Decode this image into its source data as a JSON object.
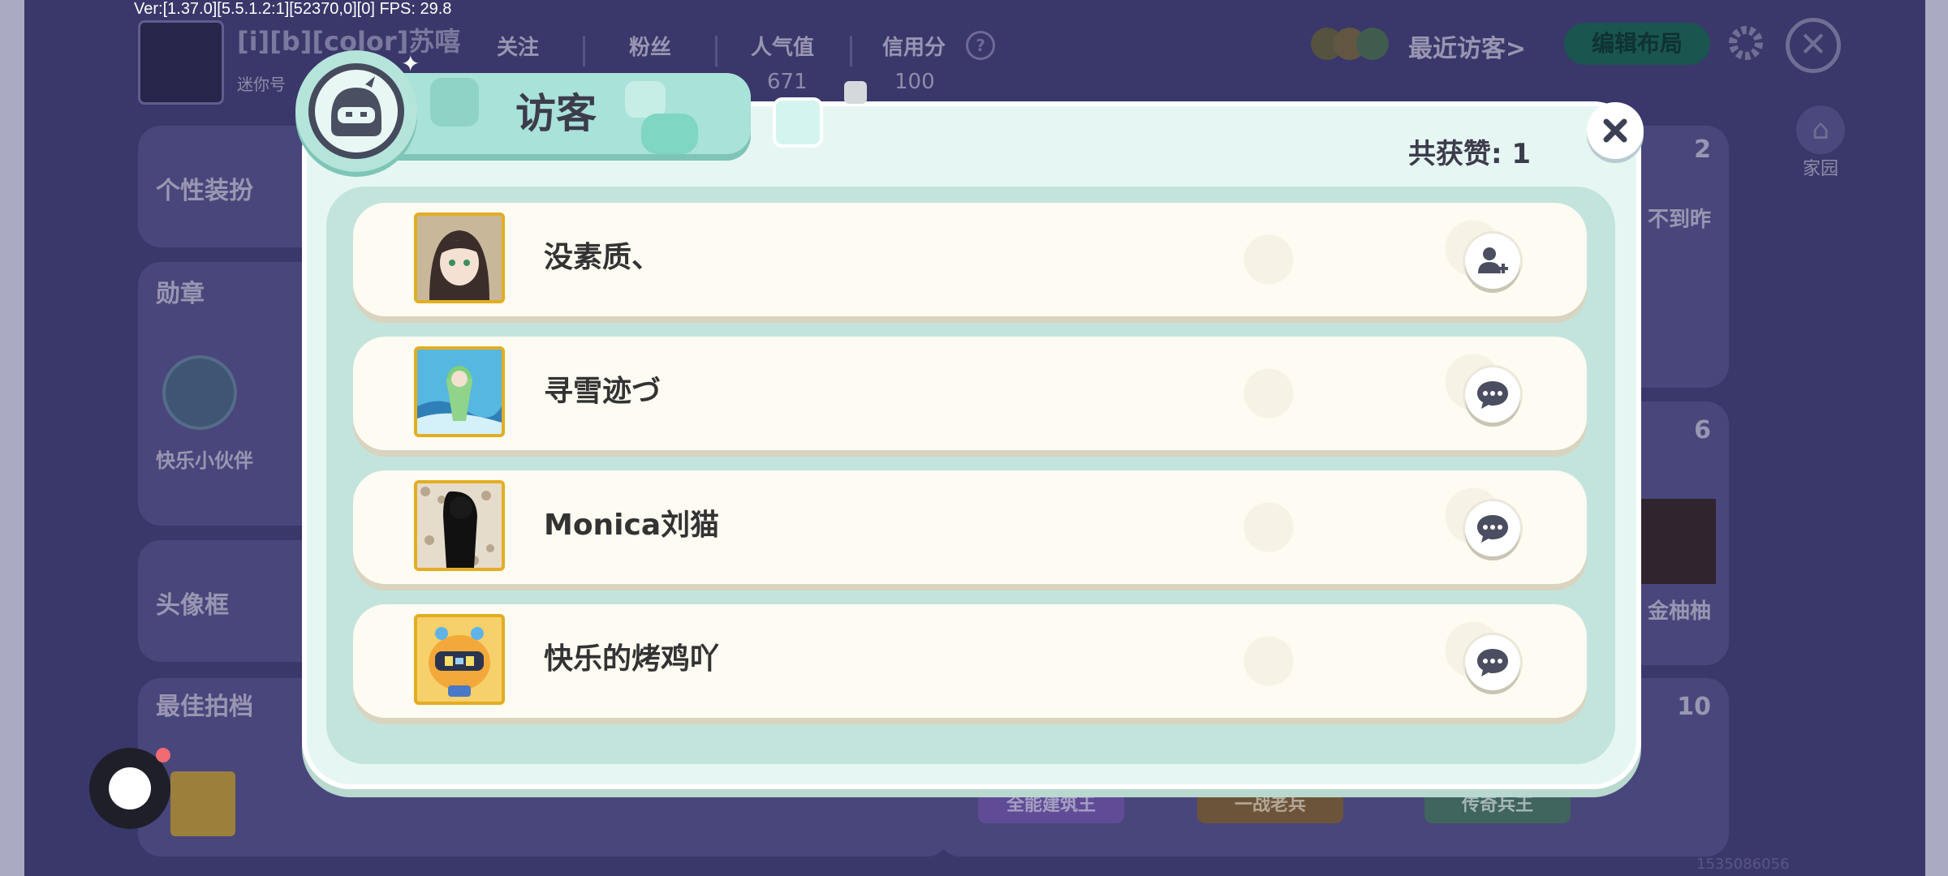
{
  "debug": {
    "text": "Ver:[1.37.0][5.5.1.2:1][52370,0][0] FPS: 29.8"
  },
  "profile": {
    "name": "[i][b][color]苏嘻",
    "mini_id_label": "迷你号",
    "stats": [
      {
        "label": "关注",
        "value": ""
      },
      {
        "label": "粉丝",
        "value": ""
      },
      {
        "label": "人气值",
        "value": "671"
      },
      {
        "label": "信用分",
        "value": "100"
      }
    ]
  },
  "header": {
    "recent_visitors": "最近访客>",
    "edit_layout": "编辑布局",
    "home": "家园"
  },
  "background_sections": {
    "dress": "个性装扮",
    "medals": "勋章",
    "medal_item": "快乐小伙伴",
    "frames": "头像框",
    "partners": "最佳拍档",
    "right_count_1": "2",
    "right_text_1": "不到昨",
    "right_count_2": "6",
    "right_text_2": "金柚柚",
    "right_count_3": "10",
    "badges": [
      "全能建筑王",
      "一战老兵",
      "传奇兵王"
    ],
    "footer_id": "1535086056"
  },
  "dialog": {
    "title": "访客",
    "likes": "共获赞: 1",
    "visitors": [
      {
        "name": "没素质、",
        "action": "add-friend-icon"
      },
      {
        "name": "寻雪迹づ",
        "action": "chat-icon"
      },
      {
        "name": "Monica刘猫",
        "action": "chat-icon"
      },
      {
        "name": "快乐的烤鸡吖",
        "action": "chat-icon"
      }
    ]
  },
  "colors": {
    "background": "#47437a",
    "dialog": "#e6f7f3",
    "row": "#fdfbf2",
    "accent_green": "#1fa37a",
    "avatar_border": "#e3ad23"
  }
}
